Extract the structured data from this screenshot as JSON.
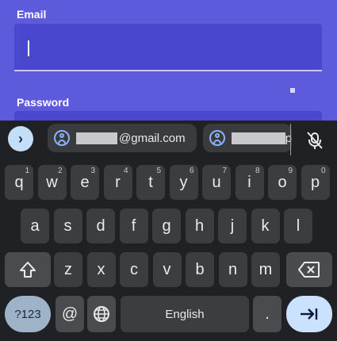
{
  "form": {
    "email_label": "Email",
    "email_value": "",
    "password_label": "Password"
  },
  "suggestions": {
    "expand_glyph": "›",
    "chip1_domain": "@gmail.com",
    "chip2_suffix": "p"
  },
  "keyboard": {
    "row1": [
      {
        "label": "q",
        "hint": "1"
      },
      {
        "label": "w",
        "hint": "2"
      },
      {
        "label": "e",
        "hint": "3"
      },
      {
        "label": "r",
        "hint": "4"
      },
      {
        "label": "t",
        "hint": "5"
      },
      {
        "label": "y",
        "hint": "6"
      },
      {
        "label": "u",
        "hint": "7"
      },
      {
        "label": "i",
        "hint": "8"
      },
      {
        "label": "o",
        "hint": "9"
      },
      {
        "label": "p",
        "hint": "0"
      }
    ],
    "row2": [
      "a",
      "s",
      "d",
      "f",
      "g",
      "h",
      "j",
      "k",
      "l"
    ],
    "row3": [
      "z",
      "x",
      "c",
      "v",
      "b",
      "n",
      "m"
    ],
    "symbols_label": "?123",
    "at_label": "@",
    "space_label": "English",
    "period_label": "."
  },
  "colors": {
    "form_bg": "#5d5bdc",
    "keyboard_bg": "#202124",
    "accent": "#a8c7fa"
  }
}
